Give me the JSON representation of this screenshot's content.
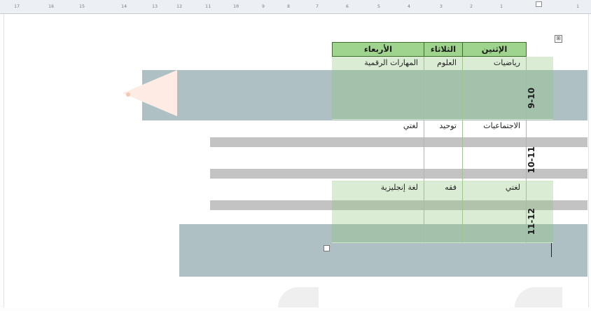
{
  "ruler": {
    "ticks": [
      "17",
      "16",
      "15",
      "14",
      "13",
      "12",
      "11",
      "10",
      "9",
      "8",
      "7",
      "6",
      "5",
      "4",
      "3",
      "2",
      "1",
      "1"
    ]
  },
  "table": {
    "headers": [
      "الإثنين",
      "الثلاثاء",
      "الأربعاء"
    ],
    "rows": [
      {
        "time": "9-10",
        "cells": [
          "رياضيات",
          "العلوم",
          "المهارات الرقمية"
        ]
      },
      {
        "time": "10-11",
        "cells": [
          "الاجتماعيات",
          "توحيد",
          "لغتي"
        ]
      },
      {
        "time": "11-12",
        "cells": [
          "لغتي",
          "فقه",
          "لغة إنجليزية"
        ]
      }
    ],
    "move_handle_glyph": "⊞"
  },
  "colors": {
    "header_green": "#9fd48e",
    "cell_green": "#bfe2b2",
    "band_slate": "#aec0c4",
    "band_gray": "#c3c3c3",
    "arrow_peach": "#fdebe4"
  },
  "icons": [
    "table-move-handle-icon",
    "table-resize-handle-icon",
    "left-arrow-shape"
  ]
}
